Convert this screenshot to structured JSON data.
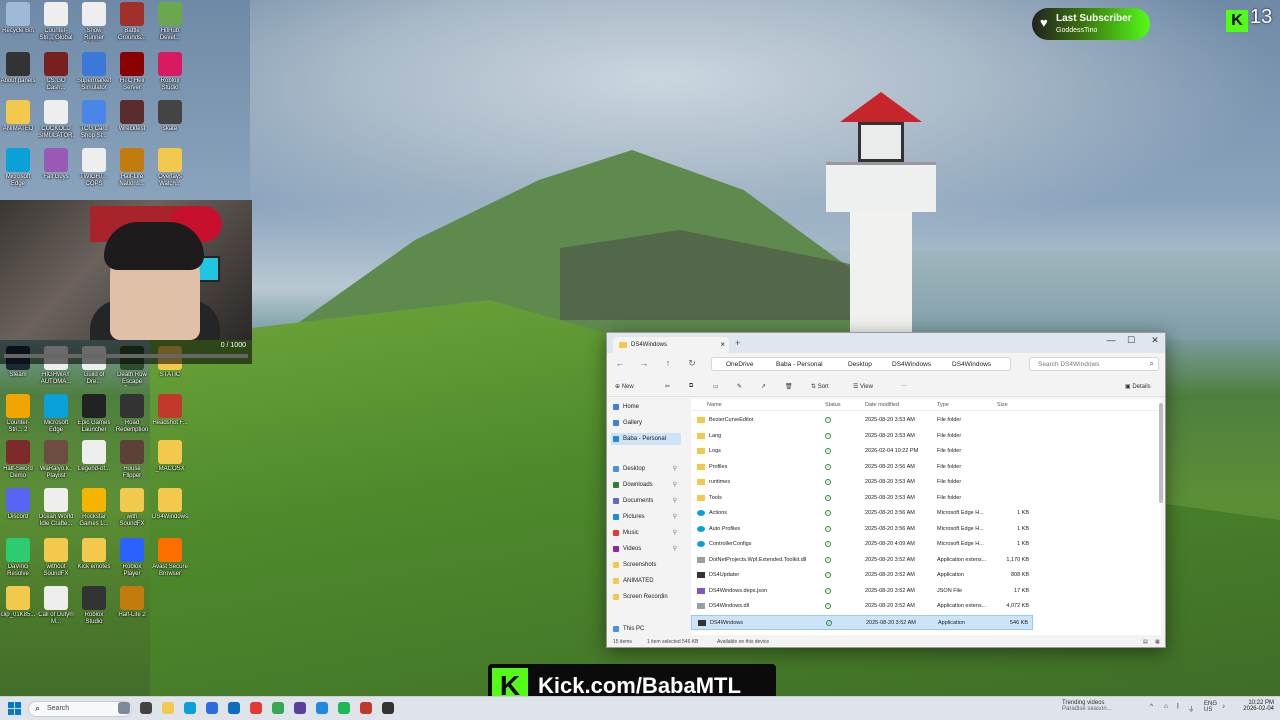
{
  "desktop": {
    "icons": [
      {
        "label": "Recycle Bin",
        "color": "#9fb9d6"
      },
      {
        "label": "Counter-Stri... Global Offe...",
        "color": "#eeeeee"
      },
      {
        "label": "Snow Runner Rising...",
        "color": "#eeeeee"
      },
      {
        "label": "Battle Grounds...",
        "color": "#a0302a"
      },
      {
        "label": "HitHub Devel...",
        "color": "#6aa84f"
      },
      {
        "label": "About panels",
        "color": "#333333"
      },
      {
        "label": "CS:GO Cash...",
        "color": "#7a1f1f"
      },
      {
        "label": "Supermarket Simulator",
        "color": "#3b78d8"
      },
      {
        "label": "HTC Heli Server",
        "color": "#8b0000"
      },
      {
        "label": "Roblox Studio",
        "color": "#d81b60"
      },
      {
        "label": "ANIMATED",
        "color": "#f2c94c"
      },
      {
        "label": "CUCKOLD SIMULATOR...",
        "color": "#eeeeee"
      },
      {
        "label": "TCG Card Shop Si...",
        "color": "#4a86e8"
      },
      {
        "label": "Wreckfest",
        "color": "#5b2c2c"
      },
      {
        "label": "skate",
        "color": "#444444"
      },
      {
        "label": "Microsoft Edge",
        "color": "#0aa0d8"
      },
      {
        "label": "Fall Guys",
        "color": "#9b59b6"
      },
      {
        "label": "TWIGHT... COPS",
        "color": "#eeeeee"
      },
      {
        "label": "Half-Life Nations...",
        "color": "#c27c0e"
      },
      {
        "label": "Overlays Watch...",
        "color": "#f2c94c"
      },
      {
        "label": "Steam",
        "color": "#1b2838"
      },
      {
        "label": "HIGHWAY AUTOMA...",
        "color": "#eeeeee"
      },
      {
        "label": "Guild of Dre...",
        "color": "#eeeeee"
      },
      {
        "label": "Death Row Escape Demo",
        "color": "#2e4d2e"
      },
      {
        "label": "STATIC",
        "color": "#f2c94c"
      },
      {
        "label": "Counter-Stri... 2",
        "color": "#f0a500"
      },
      {
        "label": "Microsoft Edge",
        "color": "#0aa0d8"
      },
      {
        "label": "Epic Games Launcher",
        "color": "#222222"
      },
      {
        "label": "Road Redemption",
        "color": "#333333"
      },
      {
        "label": "Headshot F...",
        "color": "#c0392b"
      },
      {
        "label": "Half-Sword Demo",
        "color": "#7f2a2a"
      },
      {
        "label": "WaRaiyo.k.. Playlist",
        "color": "#6d4c41"
      },
      {
        "label": "Legend-of...",
        "color": "#eeeeee"
      },
      {
        "label": "House Flipper",
        "color": "#5d4037"
      },
      {
        "label": "_MACOSX",
        "color": "#f2c94c"
      },
      {
        "label": "Discord",
        "color": "#5865f2"
      },
      {
        "label": "Ocean World Idle Crafte...",
        "color": "#eeeeee"
      },
      {
        "label": "Rockstar Games L...",
        "color": "#f4b400"
      },
      {
        "label": "with SoundFX",
        "color": "#f2c94c"
      },
      {
        "label": "DS4Windows",
        "color": "#f2c94c"
      },
      {
        "label": "DaVinci Resolve",
        "color": "#2ecc71"
      },
      {
        "label": "without SoundFX",
        "color": "#f2c94c"
      },
      {
        "label": "Kick emotes",
        "color": "#f2c94c"
      },
      {
        "label": "Roblox Player",
        "color": "#2962ff"
      },
      {
        "label": "Avast Secure Browser",
        "color": "#ff6f00"
      },
      {
        "label": "clip_01K85...",
        "color": "#f2c94c"
      },
      {
        "label": "Call of Duty® M...",
        "color": "#eeeeee"
      },
      {
        "label": "Roblox Studio",
        "color": "#333333"
      },
      {
        "label": "Half-Life 2",
        "color": "#c27c0e"
      }
    ]
  },
  "webcam": {
    "progress_text": "0 / 1000",
    "progress_fraction": 0
  },
  "overlay": {
    "subscriber_title": "Last Subscriber",
    "subscriber_name": "GoddessTino",
    "kick_count": "13",
    "kick_corner_logo": "K",
    "banner_logo": "K",
    "banner_text": "Kick.com/BabaMTL"
  },
  "explorer": {
    "tab_title": "DS4Windows",
    "tab_close": "×",
    "new_tab": "+",
    "controls": {
      "minimize": "—",
      "maximize": "☐",
      "close": "✕"
    },
    "nav": {
      "back": "←",
      "forward": "→",
      "up": "↑",
      "refresh": "↻"
    },
    "breadcrumb": [
      "OneDrive",
      "Baba - Personal",
      "Desktop",
      "DS4Windows",
      "DS4Windows"
    ],
    "search_placeholder": "Search DS4Windows",
    "commands": {
      "new": "New",
      "sort": "Sort",
      "view": "View",
      "more": "···",
      "details": "Details"
    },
    "nav_pane": [
      {
        "label": "Home",
        "color": "#3f7fd0",
        "pinned": false,
        "selected": false
      },
      {
        "label": "Gallery",
        "color": "#3f7fd0",
        "pinned": false,
        "selected": false
      },
      {
        "label": "Baba - Personal",
        "color": "#1e88e5",
        "pinned": false,
        "selected": true
      },
      {
        "label": "Desktop",
        "color": "#4a90e2",
        "pinned": true,
        "selected": false
      },
      {
        "label": "Downloads",
        "color": "#2e7d32",
        "pinned": true,
        "selected": false
      },
      {
        "label": "Documents",
        "color": "#5c6bc0",
        "pinned": true,
        "selected": false
      },
      {
        "label": "Pictures",
        "color": "#1e88e5",
        "pinned": true,
        "selected": false
      },
      {
        "label": "Music",
        "color": "#e53935",
        "pinned": true,
        "selected": false
      },
      {
        "label": "Videos",
        "color": "#8e24aa",
        "pinned": true,
        "selected": false
      },
      {
        "label": "Screenshots",
        "color": "#f2c94c",
        "pinned": false,
        "selected": false
      },
      {
        "label": "ANIMATED",
        "color": "#f2c94c",
        "pinned": false,
        "selected": false
      },
      {
        "label": "Screen Recordin",
        "color": "#f2c94c",
        "pinned": false,
        "selected": false
      },
      {
        "label": "This PC",
        "color": "#4a90e2",
        "pinned": false,
        "selected": false
      }
    ],
    "columns": {
      "name": "Name",
      "status": "Status",
      "date": "Date modified",
      "type": "Type",
      "size": "Size"
    },
    "files": [
      {
        "name": "BezierCurveEditor",
        "date": "2025-08-20 3:53 AM",
        "type": "File folder",
        "size": "",
        "icon": "folder"
      },
      {
        "name": "Lang",
        "date": "2025-08-20 3:53 AM",
        "type": "File folder",
        "size": "",
        "icon": "folder"
      },
      {
        "name": "Logs",
        "date": "2026-02-04 10:22 PM",
        "type": "File folder",
        "size": "",
        "icon": "folder"
      },
      {
        "name": "Profiles",
        "date": "2025-08-20 3:56 AM",
        "type": "File folder",
        "size": "",
        "icon": "folder"
      },
      {
        "name": "runtimes",
        "date": "2025-08-20 3:53 AM",
        "type": "File folder",
        "size": "",
        "icon": "folder"
      },
      {
        "name": "Tools",
        "date": "2025-08-20 3:53 AM",
        "type": "File folder",
        "size": "",
        "icon": "folder"
      },
      {
        "name": "Actions",
        "date": "2025-08-20 3:56 AM",
        "type": "Microsoft Edge H...",
        "size": "1 KB",
        "icon": "edge"
      },
      {
        "name": "Auto Profiles",
        "date": "2025-08-20 3:56 AM",
        "type": "Microsoft Edge H...",
        "size": "1 KB",
        "icon": "edge"
      },
      {
        "name": "ControllerConfigs",
        "date": "2025-08-20 4:09 AM",
        "type": "Microsoft Edge H...",
        "size": "1 KB",
        "icon": "edge"
      },
      {
        "name": "DotNetProjects.Wpf.Extended.Toolkit.dll",
        "date": "2025-08-20 3:52 AM",
        "type": "Application extens...",
        "size": "1,170 KB",
        "icon": "dll"
      },
      {
        "name": "DS4Updater",
        "date": "2025-08-20 3:52 AM",
        "type": "Application",
        "size": "808 KB",
        "icon": "app"
      },
      {
        "name": "DS4Windows.deps.json",
        "date": "2025-08-20 3:52 AM",
        "type": "JSON File",
        "size": "17 KB",
        "icon": "json"
      },
      {
        "name": "DS4Windows.dll",
        "date": "2025-08-20 3:52 AM",
        "type": "Application extens...",
        "size": "4,072 KB",
        "icon": "dll"
      },
      {
        "name": "DS4Windows",
        "date": "2025-08-20 3:52 AM",
        "type": "Application",
        "size": "546 KB",
        "icon": "app"
      }
    ],
    "selected_index": 13,
    "status": {
      "items": "15 items",
      "selected": "1 item selected  546 KB",
      "availability": "Available on this device"
    }
  },
  "taskbar": {
    "search_label": "Search",
    "news_title": "Trending videos",
    "news_sub": "Paradise season...",
    "lang": "ENG",
    "region": "US",
    "time": "10:22 PM",
    "date": "2026-02-04",
    "apps": [
      {
        "name": "copilot",
        "color": "#7b8a9a"
      },
      {
        "name": "task-view",
        "color": "#444444"
      },
      {
        "name": "file-explorer",
        "color": "#f2c94c"
      },
      {
        "name": "edge",
        "color": "#0aa0d8"
      },
      {
        "name": "store",
        "color": "#2d6cdf"
      },
      {
        "name": "mail",
        "color": "#0f6cbd"
      },
      {
        "name": "opera",
        "color": "#e53935"
      },
      {
        "name": "chrome",
        "color": "#34a853"
      },
      {
        "name": "obs",
        "color": "#5a3fa0"
      },
      {
        "name": "vpn",
        "color": "#1e88e5"
      },
      {
        "name": "spotify",
        "color": "#1db954"
      },
      {
        "name": "davinci",
        "color": "#c0392b"
      },
      {
        "name": "app-12",
        "color": "#333333"
      }
    ]
  }
}
